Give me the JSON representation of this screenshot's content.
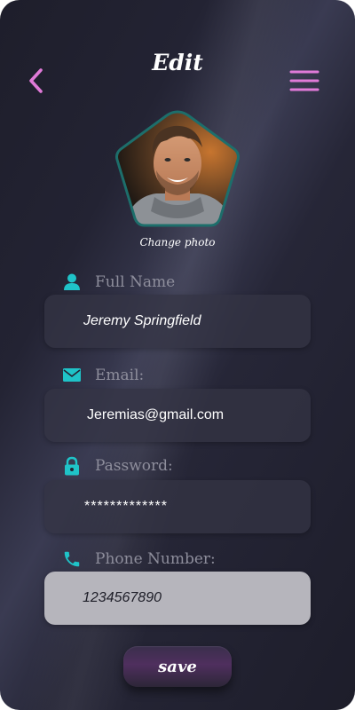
{
  "header": {
    "title": "Edit",
    "back_icon": "chevron-left-icon",
    "menu_icon": "hamburger-menu-icon"
  },
  "profile": {
    "change_photo_label": "Change photo"
  },
  "form": {
    "full_name": {
      "label": "Full Name",
      "value": "Jeremy Springfield",
      "icon": "user-icon"
    },
    "email": {
      "label": "Email:",
      "value": "Jeremias@gmail.com",
      "icon": "mail-icon"
    },
    "password": {
      "label": "Password:",
      "value": "*************",
      "icon": "lock-icon"
    },
    "phone": {
      "label": "Phone Number:",
      "value": "1234567890",
      "icon": "phone-icon"
    }
  },
  "actions": {
    "save_label": "save"
  },
  "colors": {
    "accent_pink": "#e07ad8",
    "icon_cyan": "#1fc3c8",
    "background": "#232333",
    "phone_field_bg": "#b6b5bc"
  }
}
